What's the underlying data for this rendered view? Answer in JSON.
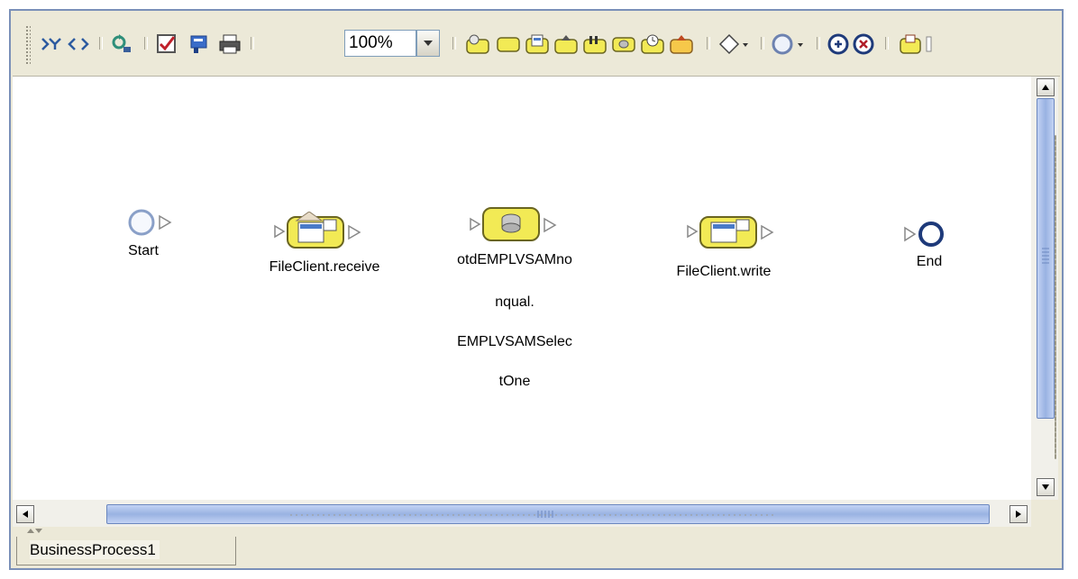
{
  "toolbar": {
    "zoom_value": "100%",
    "icons": [
      "map-icon",
      "code-icon",
      "refresh-icon",
      "validate-icon",
      "flag-icon",
      "print-icon",
      "receive-activity-icon",
      "empty-activity-icon",
      "service-icon",
      "upload-activity-icon",
      "flow-icon",
      "database-icon",
      "timer-activity-icon",
      "export-activity-icon",
      "decision-icon",
      "event-icon",
      "catch-event-icon",
      "stop-icon",
      "calendar-icon"
    ]
  },
  "canvas": {
    "nodes": {
      "start": {
        "label": "Start"
      },
      "receive": {
        "label": "FileClient.receive"
      },
      "select": {
        "label_lines": [
          "otdEMPLVSAMno",
          "nqual.",
          "EMPLVSAMSelec",
          "tOne"
        ]
      },
      "write": {
        "label": "FileClient.write"
      },
      "end": {
        "label": "End"
      }
    }
  },
  "tabs": [
    {
      "label": "BusinessProcess1",
      "active": true
    }
  ],
  "colors": {
    "activity_yellow": "#f2ea55",
    "scroll_thumb": "#99b2e2",
    "start_ring": "#8aa0c8",
    "end_ring": "#1e3a7a"
  }
}
